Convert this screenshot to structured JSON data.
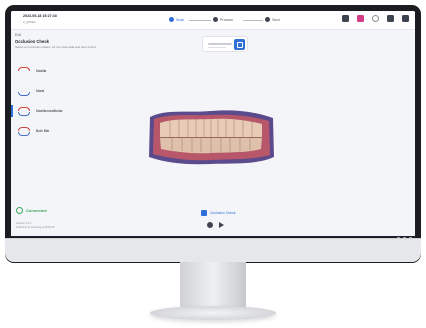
{
  "header": {
    "case_id": "2023-05-18 15:27:43",
    "case_name": "2_gOhEn",
    "steps": [
      {
        "label": "Scan",
        "active": true
      },
      {
        "label": "Process",
        "active": false
      },
      {
        "label": "Save",
        "active": false
      }
    ]
  },
  "panel": {
    "back_label": "Exit",
    "title": "Occlusion Check",
    "subtitle": "Select an occlusion pattern for the scan data and then export",
    "options": [
      {
        "label": "Maxilla",
        "selected": false
      },
      {
        "label": "Mand",
        "selected": false
      },
      {
        "label": "Maxillomandibular",
        "selected": true
      },
      {
        "label": "Both Bite",
        "selected": false
      }
    ]
  },
  "status": {
    "connected_label": "Connected",
    "footer_line1": "Version 1.0.0",
    "footer_line2": "Total time of scanning is 00:02:15"
  },
  "bottom": {
    "occlusion_label": "Occlusion Check"
  },
  "colors": {
    "accent": "#2f6fd8",
    "connected": "#3aa55a"
  }
}
